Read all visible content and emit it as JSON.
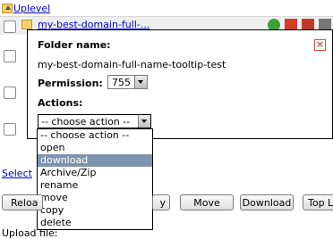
{
  "uplevel": {
    "label": "Uplevel"
  },
  "row": {
    "name": "my-best-domain-full-..."
  },
  "tooltip": {
    "folder_name_label": "Folder name:",
    "folder_name_value": "my-best-domain-full-name-tooltip-test",
    "permission_label": "Permission:",
    "permission_value": "755",
    "actions_label": "Actions:",
    "action_placeholder": "-- choose action --"
  },
  "action_options": [
    "-- choose action --",
    "open",
    "download",
    "Archive/Zip",
    "rename",
    "move",
    "copy",
    "delete"
  ],
  "selected_option": "download",
  "select_link": "Select",
  "buttons": {
    "reload": "Reloa",
    "copy": "y",
    "move": "Move",
    "download": "Download",
    "top": "Top Le"
  },
  "upload_label": "Upload file:"
}
